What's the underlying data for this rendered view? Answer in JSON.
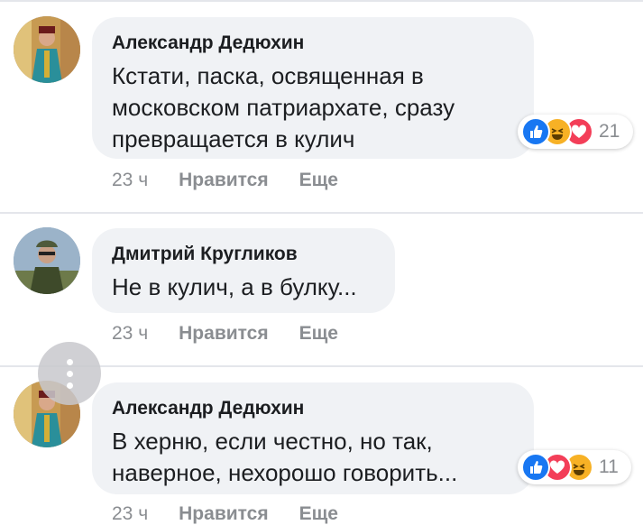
{
  "comments": [
    {
      "author": "Александр Дедюхин",
      "text": "Кстати, паска, освященная в\nмосковском патриархате, сразу\nпревращается в кулич",
      "time": "23 ч",
      "like_label": "Нравится",
      "more_label": "Еще",
      "reactions": [
        "like",
        "haha",
        "love"
      ],
      "reaction_count": "21"
    },
    {
      "author": "Дмитрий Кругликов",
      "text": "Не в кулич, а в булку...",
      "time": "23 ч",
      "like_label": "Нравится",
      "more_label": "Еще"
    },
    {
      "author": "Александр Дедюхин",
      "text": "В херню, если честно, но так,\nнаверное, нехорошо говорить...",
      "time": "23 ч",
      "like_label": "Нравится",
      "more_label": "Еще",
      "reactions": [
        "like",
        "love",
        "haha"
      ],
      "reaction_count": "11"
    }
  ],
  "colors": {
    "bubble": "#f0f2f5",
    "meta_text": "#8a8d91",
    "like_blue": "#1877f2",
    "haha_yellow": "#f7b125",
    "love_red": "#f33e58"
  },
  "icons": [
    "thumbs-up-icon",
    "laughing-face-icon",
    "heart-icon",
    "more-vertical-icon"
  ]
}
